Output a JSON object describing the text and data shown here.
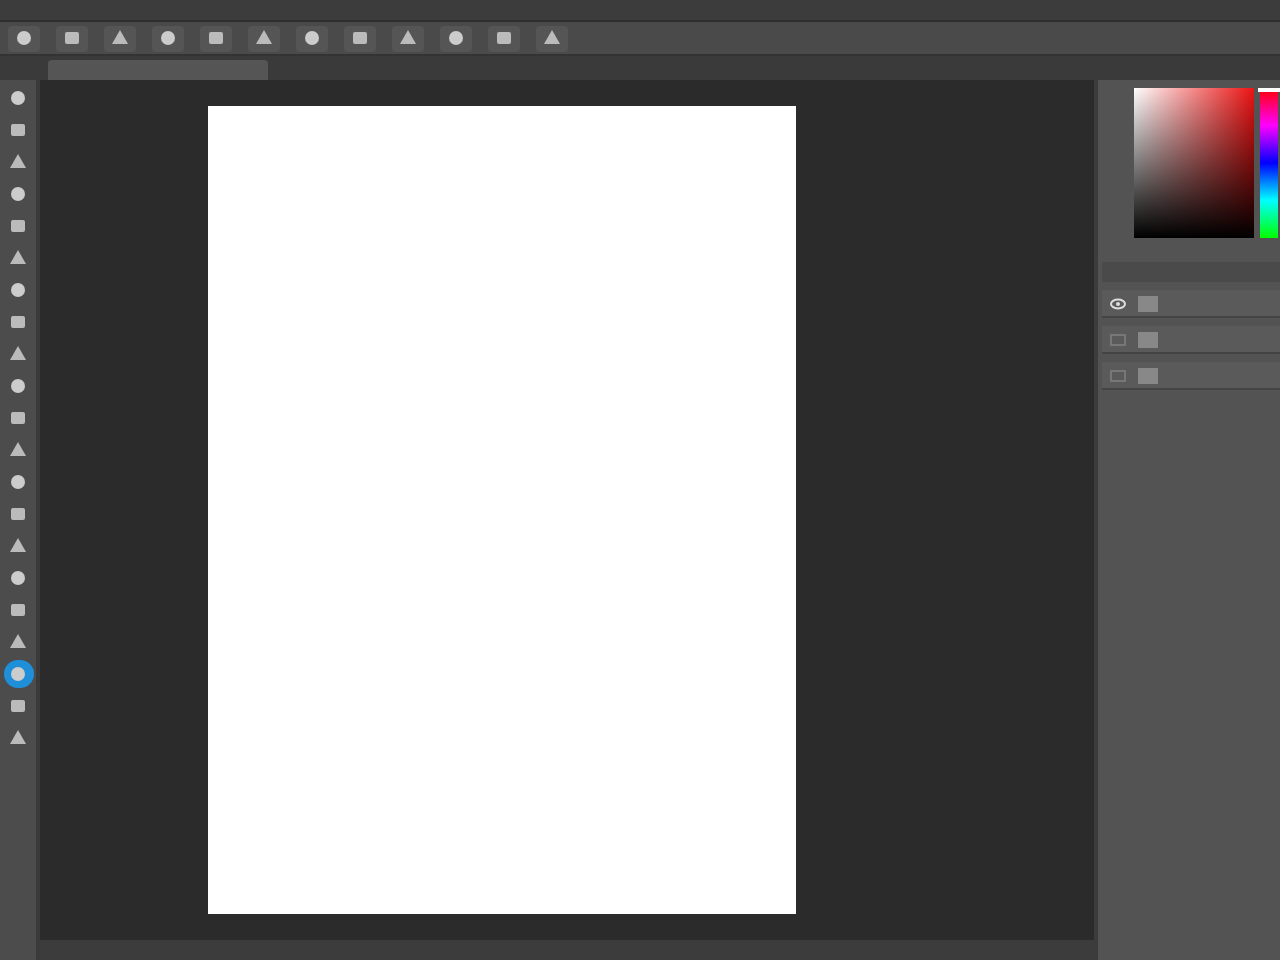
{
  "tools": [
    {
      "selected": false
    },
    {
      "selected": false
    },
    {
      "selected": false
    },
    {
      "selected": false
    },
    {
      "selected": false
    },
    {
      "selected": false
    },
    {
      "selected": false
    },
    {
      "selected": false
    },
    {
      "selected": false
    },
    {
      "selected": false
    },
    {
      "selected": false
    },
    {
      "selected": false
    },
    {
      "selected": false
    },
    {
      "selected": false
    },
    {
      "selected": false
    },
    {
      "selected": false
    },
    {
      "selected": false
    },
    {
      "selected": false
    },
    {
      "selected": true
    },
    {
      "selected": false
    },
    {
      "selected": false
    }
  ],
  "hue_slider": {
    "level": 1
  },
  "layers": [
    {
      "visible": true
    },
    {
      "visible": false
    },
    {
      "visible": false
    }
  ]
}
